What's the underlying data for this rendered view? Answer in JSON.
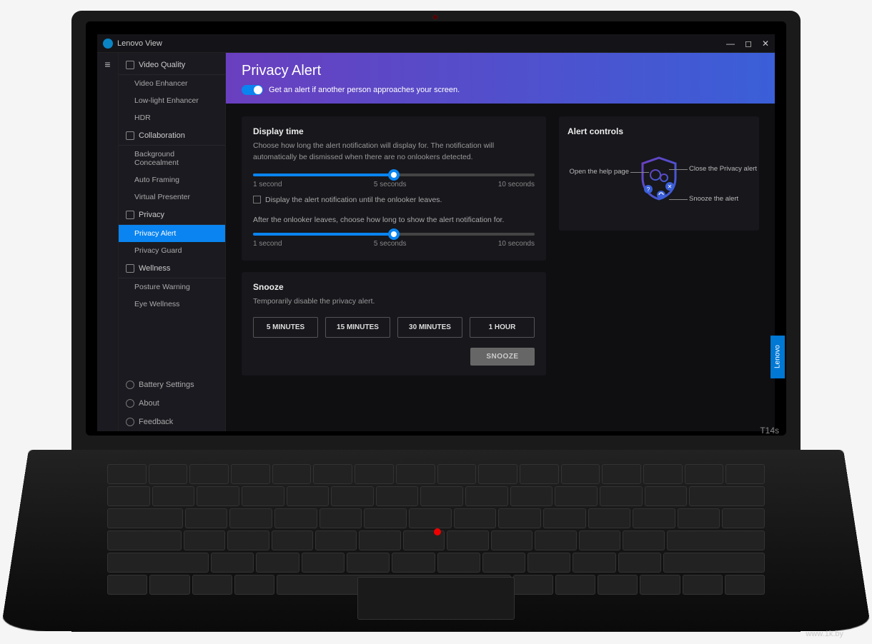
{
  "app": {
    "title": "Lenovo View"
  },
  "window": {
    "min": "—",
    "max": "◻",
    "close": "✕"
  },
  "sidebar": {
    "sections": [
      {
        "label": "Video Quality",
        "items": [
          "Video Enhancer",
          "Low-light Enhancer",
          "HDR"
        ]
      },
      {
        "label": "Collaboration",
        "items": [
          "Background Concealment",
          "Auto Framing",
          "Virtual Presenter"
        ]
      },
      {
        "label": "Privacy",
        "items": [
          "Privacy Alert",
          "Privacy Guard"
        ]
      },
      {
        "label": "Wellness",
        "items": [
          "Posture Warning",
          "Eye Wellness"
        ]
      }
    ],
    "footer": [
      "Battery Settings",
      "About",
      "Feedback"
    ]
  },
  "header": {
    "title": "Privacy Alert",
    "toggle_on": true,
    "toggle_desc": "Get an alert if another person approaches your screen."
  },
  "display_time": {
    "title": "Display time",
    "desc": "Choose how long the alert notification will display for. The notification will automatically be dismissed when there are no onlookers detected.",
    "min": "1 second",
    "mid": "5 seconds",
    "max": "10 seconds",
    "checkbox": "Display the alert notification until the onlooker leaves.",
    "after_desc": "After the onlooker leaves, choose how long to show the alert notification for."
  },
  "snooze": {
    "title": "Snooze",
    "desc": "Temporarily disable the privacy alert.",
    "options": [
      "5 MINUTES",
      "15 MINUTES",
      "30 MINUTES",
      "1 HOUR"
    ],
    "action": "SNOOZE"
  },
  "alert_controls": {
    "title": "Alert controls",
    "callouts": {
      "help": "Open the help page",
      "close": "Close the Privacy alert",
      "snooze": "Snooze the alert"
    }
  },
  "laptop": {
    "model": "T14s",
    "brand_tag": "Lenovo"
  },
  "watermark": "www.1k.by"
}
